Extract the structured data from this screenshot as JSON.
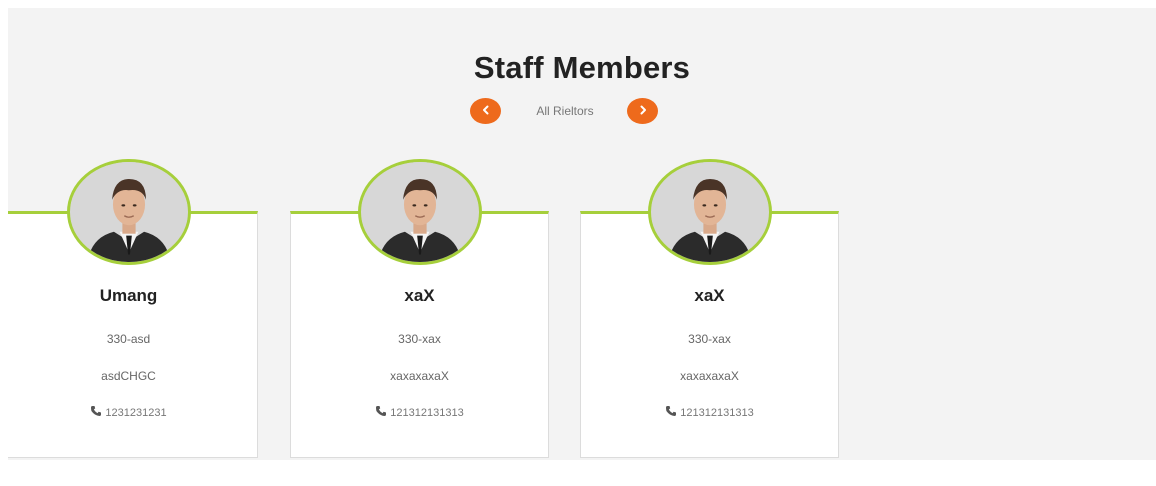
{
  "section": {
    "title": "Staff Members",
    "nav_label": "All Rieltors",
    "prev_icon": "chevron-left-icon",
    "next_icon": "chevron-right-icon",
    "accent_color": "#ee6a1c",
    "card_accent_color": "#a6cf3b"
  },
  "staff": [
    {
      "name": "Umang",
      "code": "330-asd",
      "extra": "asdCHGC",
      "phone": "1231231231",
      "phone_icon": "phone-icon",
      "avatar": "avatar-photo"
    },
    {
      "name": "xaX",
      "code": "330-xax",
      "extra": "xaxaxaxaX",
      "phone": "121312131313",
      "phone_icon": "phone-icon",
      "avatar": "avatar-photo"
    },
    {
      "name": "xaX",
      "code": "330-xax",
      "extra": "xaxaxaxaX",
      "phone": "121312131313",
      "phone_icon": "phone-icon",
      "avatar": "avatar-photo"
    }
  ]
}
